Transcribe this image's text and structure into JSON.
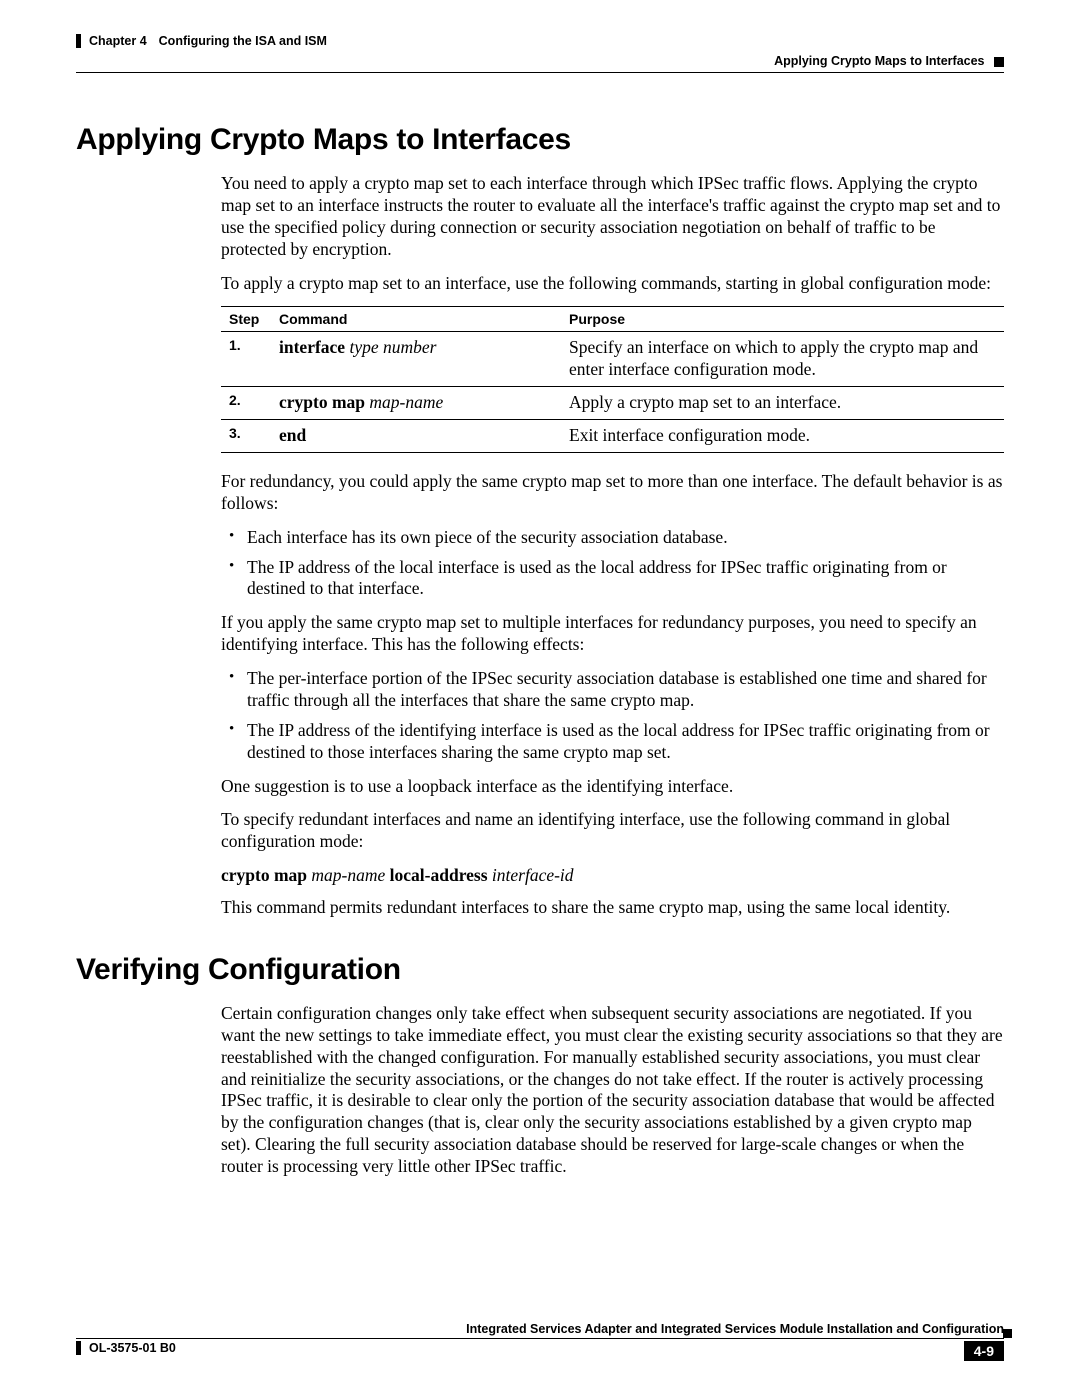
{
  "header": {
    "chapter": "Chapter 4",
    "chapter_title": "Configuring the ISA and ISM",
    "section_breadcrumb": "Applying Crypto Maps to Interfaces"
  },
  "section1": {
    "title": "Applying Crypto Maps to Interfaces",
    "p1": "You need to apply a crypto map set to each interface through which IPSec traffic flows. Applying the crypto map set to an interface instructs the router to evaluate all the interface's traffic against the crypto map set and to use the specified policy during connection or security association negotiation on behalf of traffic to be protected by encryption.",
    "p2": "To apply a crypto map set to an interface, use the following commands, starting in global configuration mode:",
    "table": {
      "headers": {
        "step": "Step",
        "command": "Command",
        "purpose": "Purpose"
      },
      "rows": [
        {
          "step": "1.",
          "cmd_bold": "interface",
          "cmd_ital": "type number",
          "purpose": "Specify an interface on which to apply the crypto map and enter interface configuration mode."
        },
        {
          "step": "2.",
          "cmd_bold": "crypto map",
          "cmd_ital": "map-name",
          "purpose": "Apply a crypto map set to an interface."
        },
        {
          "step": "3.",
          "cmd_bold": "end",
          "cmd_ital": "",
          "purpose": "Exit interface configuration mode."
        }
      ]
    },
    "p3": "For redundancy, you could apply the same crypto map set to more than one interface. The default behavior is as follows:",
    "bullets1": [
      "Each interface has its own piece of the security association database.",
      "The IP address of the local interface is used as the local address for IPSec traffic originating from or destined to that interface."
    ],
    "p4": "If you apply the same crypto map set to multiple interfaces for redundancy purposes, you need to specify an identifying interface. This has the following effects:",
    "bullets2": [
      "The per-interface portion of the IPSec security association database is established one time and shared for traffic through all the interfaces that share the same crypto map.",
      "The IP address of the identifying interface is used as the local address for IPSec traffic originating from or destined to those interfaces sharing the same crypto map set."
    ],
    "p5": "One suggestion is to use a loopback interface as the identifying interface.",
    "p6": "To specify redundant interfaces and name an identifying interface, use the following command in global configuration mode:",
    "cmd_line": {
      "b1": "crypto map",
      "i1": "map-name",
      "b2": "local-address",
      "i2": "interface-id"
    },
    "p7": "This command permits redundant interfaces to share the same crypto map, using the same local identity."
  },
  "section2": {
    "title": "Verifying Configuration",
    "p1": "Certain configuration changes only take effect when subsequent security associations are negotiated. If you want the new settings to take immediate effect, you must clear the existing security associations so that they are reestablished with the changed configuration. For manually established security associations, you must clear and reinitialize the security associations, or the changes do not take effect. If the router is actively processing IPSec traffic, it is desirable to clear only the portion of the security association database that would be affected by the configuration changes (that is, clear only the security associations established by a given crypto map set). Clearing the full security association database should be reserved for large-scale changes or when the router is processing very little other IPSec traffic."
  },
  "footer": {
    "book_title": "Integrated Services Adapter and Integrated Services Module Installation and Configuration",
    "doc_id": "OL-3575-01 B0",
    "page_num": "4-9"
  }
}
